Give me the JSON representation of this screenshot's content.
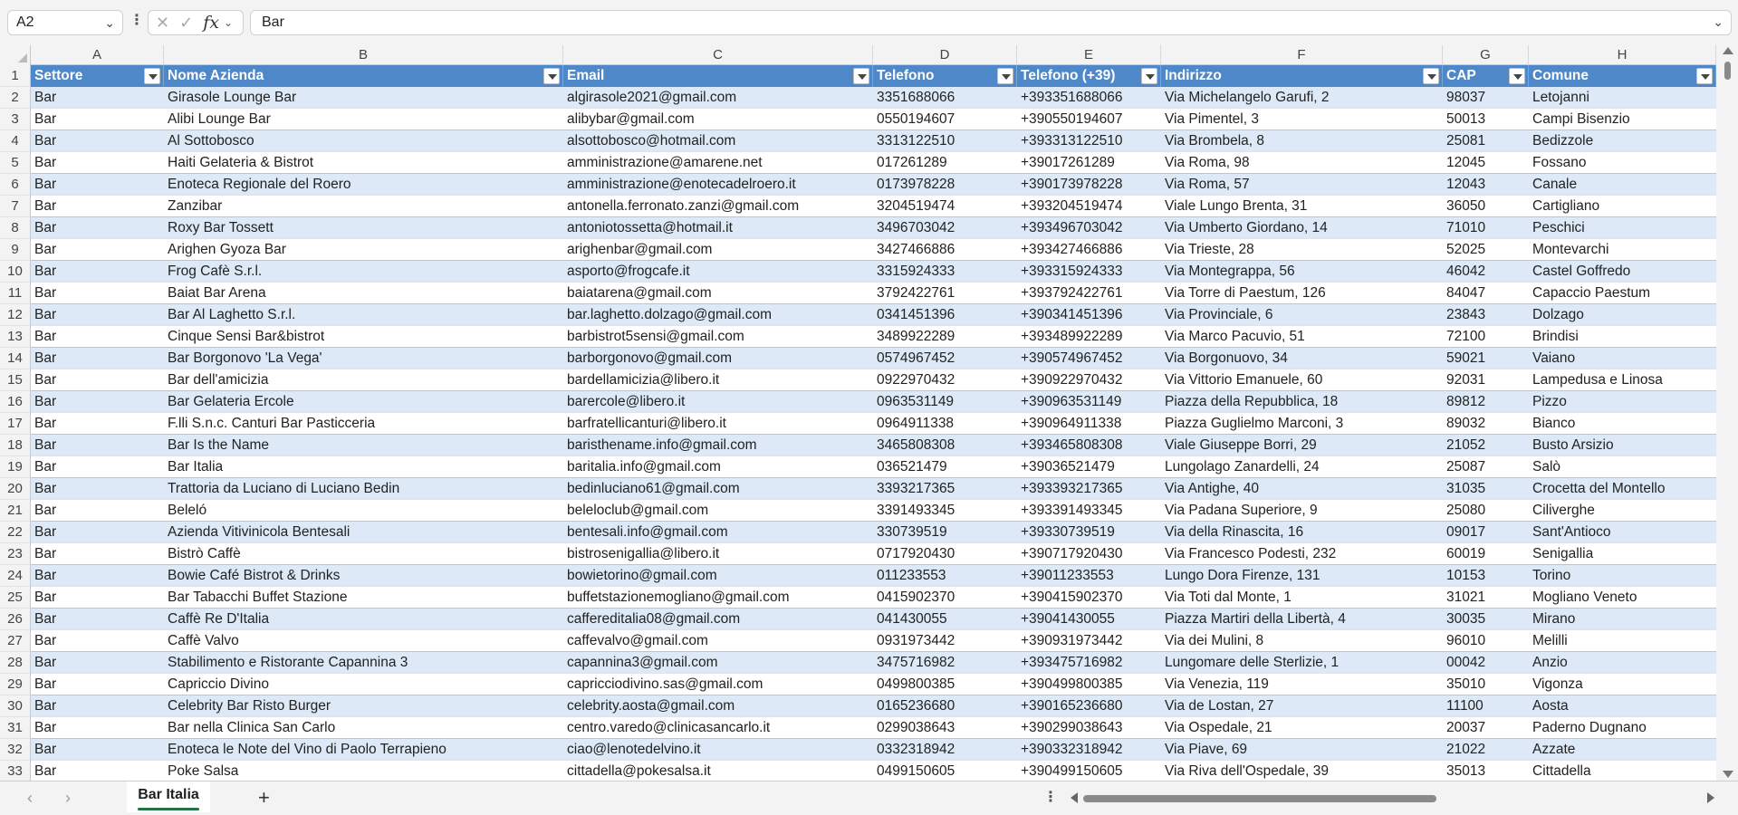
{
  "formula_bar": {
    "name_box": "A2",
    "fx_label": "fx",
    "cancel_glyph": "✕",
    "confirm_glyph": "✓",
    "value": "Bar"
  },
  "columns": [
    "A",
    "B",
    "C",
    "D",
    "E",
    "F",
    "G",
    "H"
  ],
  "table": {
    "headers": [
      "Settore",
      "Nome Azienda",
      "Email",
      "Telefono",
      "Telefono (+39)",
      "Indirizzo",
      "CAP",
      "Comune"
    ],
    "rows": [
      [
        "Bar",
        "Girasole Lounge Bar",
        "algirasole2021@gmail.com",
        "3351688066",
        "+393351688066",
        "Via Michelangelo Garufi, 2",
        "98037",
        "Letojanni"
      ],
      [
        "Bar",
        "Alibi Lounge Bar",
        "alibybar@gmail.com",
        "0550194607",
        "+390550194607",
        "Via Pimentel, 3",
        "50013",
        "Campi Bisenzio"
      ],
      [
        "Bar",
        "Al Sottobosco",
        "alsottobosco@hotmail.com",
        "3313122510",
        "+393313122510",
        "Via Brombela, 8",
        "25081",
        "Bedizzole"
      ],
      [
        "Bar",
        "Haiti Gelateria & Bistrot",
        "amministrazione@amarene.net",
        "017261289",
        "+39017261289",
        "Via Roma, 98",
        "12045",
        "Fossano"
      ],
      [
        "Bar",
        "Enoteca Regionale del Roero",
        "amministrazione@enotecadelroero.it",
        "0173978228",
        "+390173978228",
        "Via Roma, 57",
        "12043",
        "Canale"
      ],
      [
        "Bar",
        "Zanzibar",
        "antonella.ferronato.zanzi@gmail.com",
        "3204519474",
        "+393204519474",
        "Viale Lungo Brenta, 31",
        "36050",
        "Cartigliano"
      ],
      [
        "Bar",
        "Roxy Bar Tossett",
        "antoniotossetta@hotmail.it",
        "3496703042",
        "+393496703042",
        "Via Umberto Giordano, 14",
        "71010",
        "Peschici"
      ],
      [
        "Bar",
        "Arighen Gyoza Bar",
        "arighenbar@gmail.com",
        "3427466886",
        "+393427466886",
        "Via Trieste, 28",
        "52025",
        "Montevarchi"
      ],
      [
        "Bar",
        "Frog Cafè S.r.l.",
        "asporto@frogcafe.it",
        "3315924333",
        "+393315924333",
        "Via Montegrappa, 56",
        "46042",
        "Castel Goffredo"
      ],
      [
        "Bar",
        "Baiat Bar Arena",
        "baiatarena@gmail.com",
        "3792422761",
        "+393792422761",
        "Via Torre di Paestum, 126",
        "84047",
        "Capaccio Paestum"
      ],
      [
        "Bar",
        "Bar Al Laghetto S.r.l.",
        "bar.laghetto.dolzago@gmail.com",
        "0341451396",
        "+390341451396",
        "Via Provinciale, 6",
        "23843",
        "Dolzago"
      ],
      [
        "Bar",
        "Cinque Sensi Bar&bistrot",
        "barbistrot5sensi@gmail.com",
        "3489922289",
        "+393489922289",
        "Via Marco Pacuvio, 51",
        "72100",
        "Brindisi"
      ],
      [
        "Bar",
        "Bar Borgonovo 'La Vega'",
        "barborgonovo@gmail.com",
        "0574967452",
        "+390574967452",
        "Via Borgonuovo, 34",
        "59021",
        "Vaiano"
      ],
      [
        "Bar",
        "Bar dell'amicizia",
        "bardellamicizia@libero.it",
        "0922970432",
        "+390922970432",
        "Via Vittorio Emanuele, 60",
        "92031",
        "Lampedusa e Linosa"
      ],
      [
        "Bar",
        "Bar Gelateria Ercole",
        "barercole@libero.it",
        "0963531149",
        "+390963531149",
        "Piazza della Repubblica, 18",
        "89812",
        "Pizzo"
      ],
      [
        "Bar",
        "F.lli S.n.c. Canturi Bar Pasticceria",
        "barfratellicanturi@libero.it",
        "0964911338",
        "+390964911338",
        "Piazza Guglielmo Marconi, 3",
        "89032",
        "Bianco"
      ],
      [
        "Bar",
        "Bar Is the Name",
        "baristhename.info@gmail.com",
        "3465808308",
        "+393465808308",
        "Viale Giuseppe Borri, 29",
        "21052",
        "Busto Arsizio"
      ],
      [
        "Bar",
        "Bar Italia",
        "baritalia.info@gmail.com",
        "036521479",
        "+39036521479",
        "Lungolago Zanardelli, 24",
        "25087",
        "Salò"
      ],
      [
        "Bar",
        "Trattoria da Luciano di Luciano Bedin",
        "bedinluciano61@gmail.com",
        "3393217365",
        "+393393217365",
        "Via Antighe, 40",
        "31035",
        "Crocetta del Montello"
      ],
      [
        "Bar",
        "Beleló",
        "beleloclub@gmail.com",
        "3391493345",
        "+393391493345",
        "Via Padana Superiore, 9",
        "25080",
        "Ciliverghe"
      ],
      [
        "Bar",
        "Azienda Vitivinicola Bentesali",
        "bentesali.info@gmail.com",
        "330739519",
        "+39330739519",
        "Via della Rinascita, 16",
        "09017",
        "Sant'Antioco"
      ],
      [
        "Bar",
        "Bistrò Caffè",
        "bistrosenigallia@libero.it",
        "0717920430",
        "+390717920430",
        "Via Francesco Podesti, 232",
        "60019",
        "Senigallia"
      ],
      [
        "Bar",
        "Bowie Café Bistrot & Drinks",
        "bowietorino@gmail.com",
        "011233553",
        "+39011233553",
        "Lungo Dora Firenze, 131",
        "10153",
        "Torino"
      ],
      [
        "Bar",
        "Bar Tabacchi Buffet Stazione",
        "buffetstazionemogliano@gmail.com",
        "0415902370",
        "+390415902370",
        "Via Toti dal Monte, 1",
        "31021",
        "Mogliano Veneto"
      ],
      [
        "Bar",
        "Caffè Re D'Italia",
        "caffereditalia08@gmail.com",
        "041430055",
        "+39041430055",
        "Piazza Martiri della Libertà, 4",
        "30035",
        "Mirano"
      ],
      [
        "Bar",
        "Caffè Valvo",
        "caffevalvo@gmail.com",
        "0931973442",
        "+390931973442",
        "Via dei Mulini, 8",
        "96010",
        "Melilli"
      ],
      [
        "Bar",
        "Stabilimento e Ristorante Capannina 3",
        "capannina3@gmail.com",
        "3475716982",
        "+393475716982",
        "Lungomare delle Sterlizie, 1",
        "00042",
        "Anzio"
      ],
      [
        "Bar",
        "Capriccio Divino",
        "capricciodivino.sas@gmail.com",
        "0499800385",
        "+390499800385",
        "Via Venezia, 119",
        "35010",
        "Vigonza"
      ],
      [
        "Bar",
        "Celebrity Bar Risto Burger",
        "celebrity.aosta@gmail.com",
        "0165236680",
        "+390165236680",
        "Via de Lostan, 27",
        "11100",
        "Aosta"
      ],
      [
        "Bar",
        "Bar nella Clinica San Carlo",
        "centro.varedo@clinicasancarlo.it",
        "0299038643",
        "+390299038643",
        "Via Ospedale, 21",
        "20037",
        "Paderno Dugnano"
      ],
      [
        "Bar",
        "Enoteca le Note del Vino di Paolo Terrapieno",
        "ciao@lenotedelvino.it",
        "0332318942",
        "+390332318942",
        "Via Piave, 69",
        "21022",
        "Azzate"
      ],
      [
        "Bar",
        "Poke Salsa",
        "cittadella@pokesalsa.it",
        "0499150605",
        "+390499150605",
        "Via Riva dell'Ospedale, 39",
        "35013",
        "Cittadella"
      ]
    ]
  },
  "sheet_tabs": {
    "active": "Bar Italia",
    "add_label": "+"
  },
  "colors": {
    "header_fill": "#4e88c8",
    "band_fill": "#dde9f6",
    "sheet_accent": "#217346"
  }
}
